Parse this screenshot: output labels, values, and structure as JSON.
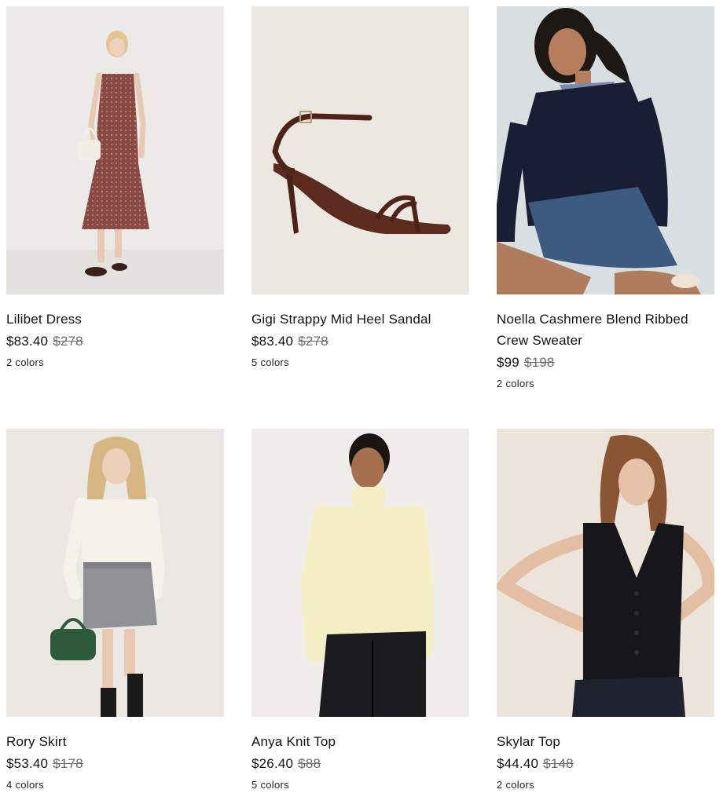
{
  "products": [
    {
      "name": "Lilibet Dress",
      "price": "$83.40",
      "original_price": "$278",
      "colors": "2 colors",
      "image_icon": "product-photo",
      "bg_color": "#eceae8"
    },
    {
      "name": "Gigi Strappy Mid Heel Sandal",
      "price": "$83.40",
      "original_price": "$278",
      "colors": "5 colors",
      "image_icon": "product-photo",
      "bg_color": "#ece8e1"
    },
    {
      "name": "Noella Cashmere Blend Ribbed Crew Sweater",
      "price": "$99",
      "original_price": "$198",
      "colors": "2 colors",
      "image_icon": "product-photo",
      "bg_color": "#d9dee1"
    },
    {
      "name": "Rory Skirt",
      "price": "$53.40",
      "original_price": "$178",
      "colors": "4 colors",
      "image_icon": "product-photo",
      "bg_color": "#ebe7e2"
    },
    {
      "name": "Anya Knit Top",
      "price": "$26.40",
      "original_price": "$88",
      "colors": "5 colors",
      "image_icon": "product-photo",
      "bg_color": "#efede9"
    },
    {
      "name": "Skylar Top",
      "price": "$44.40",
      "original_price": "$148",
      "colors": "2 colors",
      "image_icon": "product-photo",
      "bg_color": "#ece4da"
    }
  ]
}
